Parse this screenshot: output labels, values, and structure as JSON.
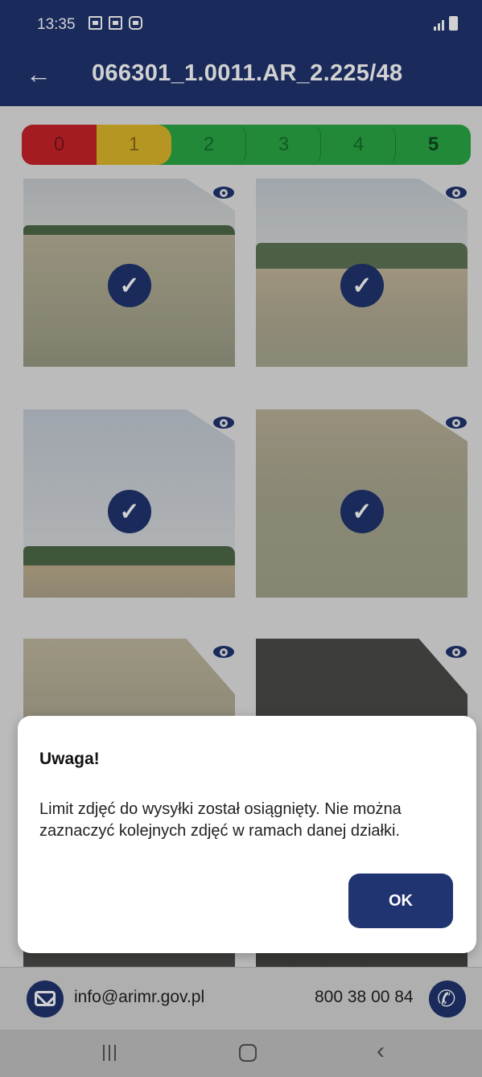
{
  "status_bar": {
    "time": "13:35",
    "icons": [
      "gallery-icon",
      "mail-notification-icon",
      "record-icon"
    ],
    "right_icons": [
      "signal-icon",
      "battery-icon"
    ]
  },
  "app_bar": {
    "title": "066301_1.0011.AR_2.225/48",
    "back_icon": "arrow-left-icon"
  },
  "rating_scale": {
    "options": [
      "0",
      "1",
      "2",
      "3",
      "4",
      "5"
    ],
    "selected": "5",
    "colors": {
      "0": "#c8232a",
      "1": "#dfb72a",
      "2-5": "#2aa845"
    }
  },
  "photos": [
    {
      "selected": true,
      "eye_icon": "eye-icon"
    },
    {
      "selected": true,
      "eye_icon": "eye-icon"
    },
    {
      "selected": true,
      "eye_icon": "eye-icon"
    },
    {
      "selected": true,
      "eye_icon": "eye-icon"
    },
    {
      "selected": false,
      "eye_icon": "eye-icon"
    },
    {
      "selected": false,
      "eye_icon": "eye-icon"
    }
  ],
  "dialog": {
    "title": "Uwaga!",
    "message": "Limit zdjęć do wysyłki został osiągnięty. Nie można zaznaczyć kolejnych zdjęć w ramach danej działki.",
    "ok_label": "OK"
  },
  "footer": {
    "email": "info@arimr.gov.pl",
    "phone": "800 38 00 84"
  },
  "theme": {
    "primary": "#1f3470"
  }
}
